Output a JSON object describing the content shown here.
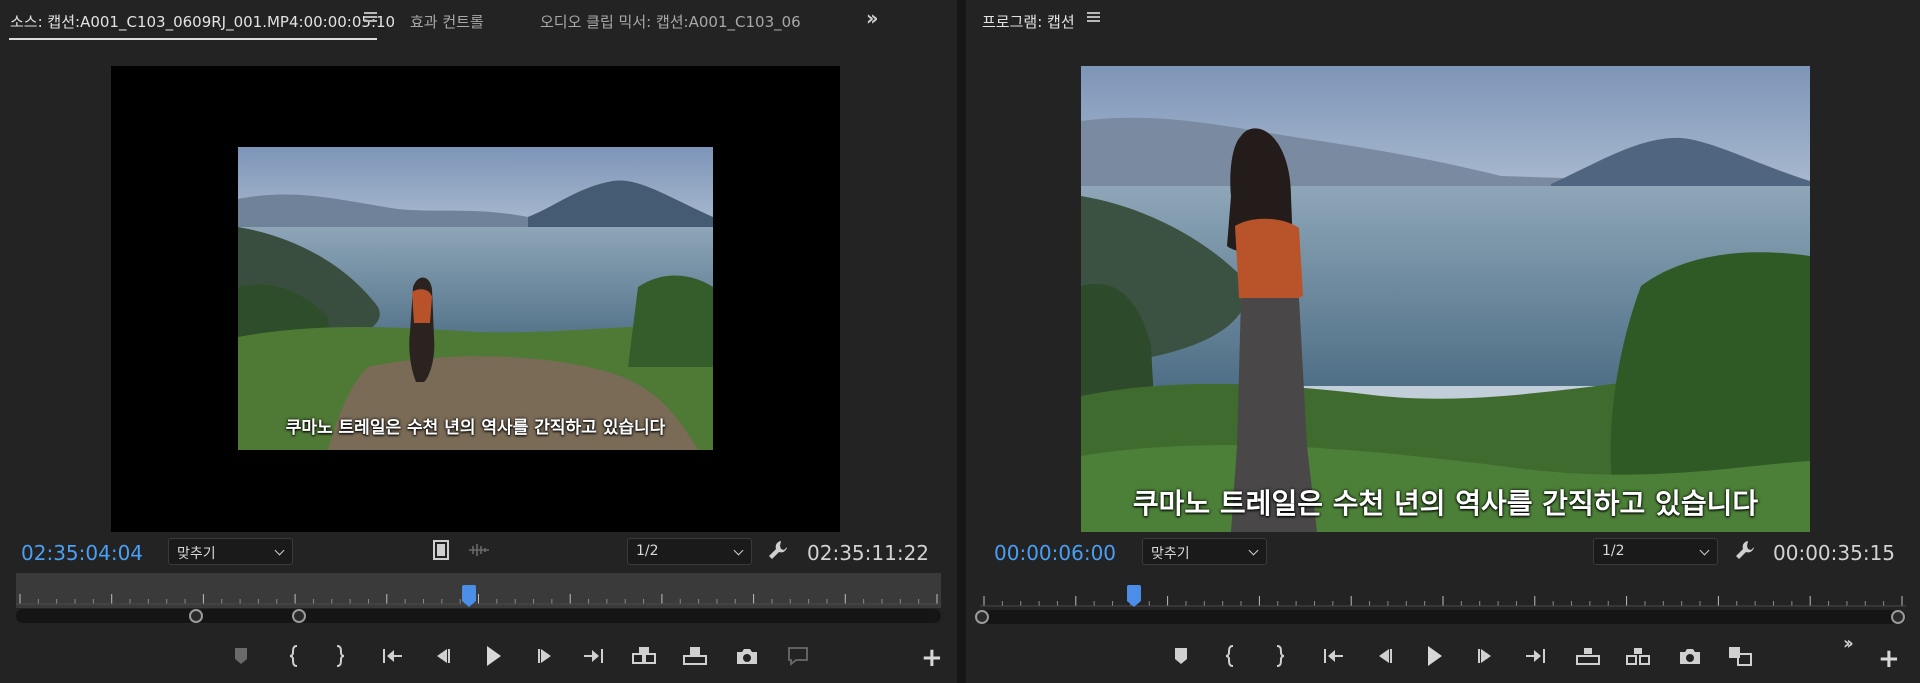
{
  "source_monitor": {
    "tabs": [
      {
        "label": "소스: 캡션:A001_C103_0609RJ_001.MP4:00:00:05:10",
        "active": true
      },
      {
        "label": "효과 컨트롤",
        "active": false
      },
      {
        "label": "오디오 클립 믹서: 캡션:A001_C103_06",
        "active": false
      }
    ],
    "caption": "쿠마노 트레일은 수천 년의 역사를 간직하고 있습니다",
    "timecode_current": "02:35:04:04",
    "timecode_duration": "02:35:11:22",
    "zoom_select": "맞추기",
    "resolution_select": "1/2",
    "playhead_position": 0.49,
    "in_point_position": 0.195,
    "out_point_position": 0.306
  },
  "program_monitor": {
    "tab_label": "프로그램: 캡션",
    "caption": "쿠마노 트레일은 수천 년의 역사를 간직하고 있습니다",
    "timecode_current": "00:00:06:00",
    "timecode_duration": "00:00:35:15",
    "zoom_select": "맞추기",
    "resolution_select": "1/2",
    "playhead_position": 0.166
  },
  "colors": {
    "accent_blue": "#4a9ff5",
    "panel_bg": "#232323",
    "viewer_bg": "#000000"
  },
  "icons": {
    "source_transport": [
      "marker-icon",
      "mark-in-icon",
      "mark-out-icon",
      "go-to-in-icon",
      "step-back-icon",
      "play-icon",
      "step-forward-icon",
      "go-to-out-icon",
      "insert-icon",
      "overwrite-icon",
      "export-frame-icon",
      "comment-icon",
      "add-button-icon"
    ],
    "program_transport": [
      "marker-icon",
      "mark-in-icon",
      "mark-out-icon",
      "go-to-in-icon",
      "step-back-icon",
      "play-icon",
      "step-forward-icon",
      "go-to-out-icon",
      "lift-icon",
      "extract-icon",
      "export-frame-icon",
      "compare-view-icon",
      "add-button-icon"
    ]
  }
}
